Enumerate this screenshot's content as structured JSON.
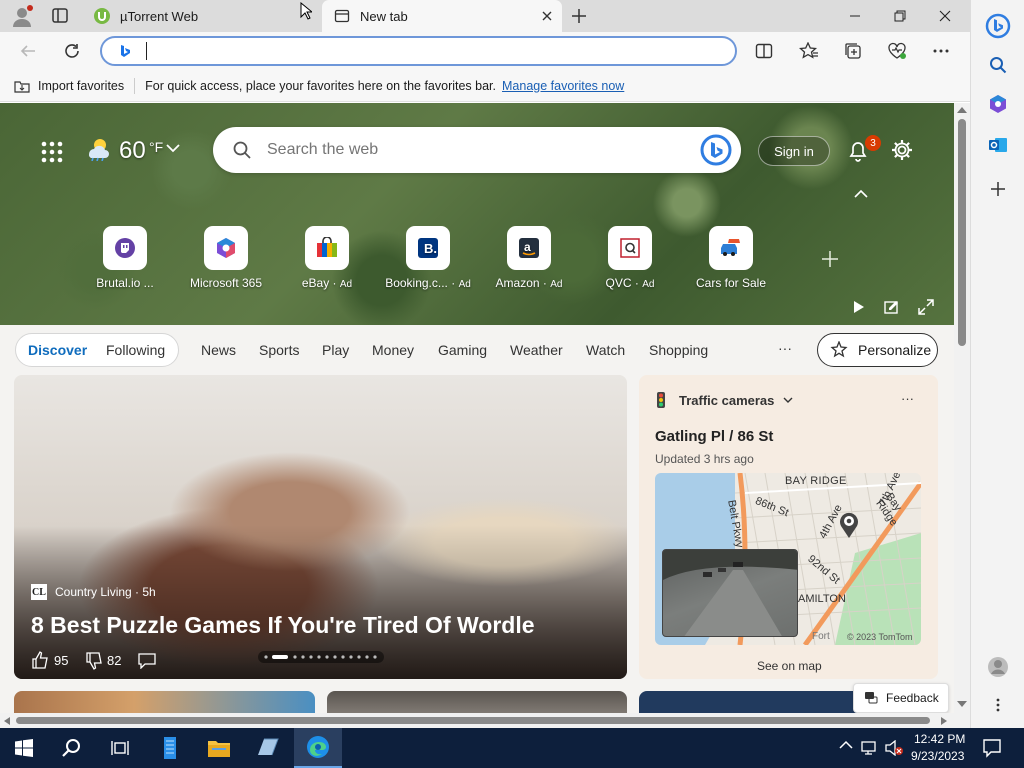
{
  "tabs": [
    {
      "title": "µTorrent Web"
    },
    {
      "title": "New tab"
    }
  ],
  "favorites_bar": {
    "import_label": "Import favorites",
    "message": "For quick access, place your favorites here on the favorites bar.",
    "manage_link": "Manage favorites now"
  },
  "weather": {
    "temp": "60",
    "unit": "°F"
  },
  "search": {
    "placeholder": "Search the web"
  },
  "header": {
    "sign_in": "Sign in",
    "notification_count": "3"
  },
  "quick_links": [
    {
      "label": "Brutal.io",
      "suffix": "...",
      "icon": "brutal-icon"
    },
    {
      "label": "Microsoft 365",
      "suffix": "",
      "icon": "m365-icon"
    },
    {
      "label": "eBay",
      "suffix": "Ad",
      "icon": "ebay-icon"
    },
    {
      "label": "Booking.c...",
      "suffix": "Ad",
      "icon": "booking-icon"
    },
    {
      "label": "Amazon",
      "suffix": "Ad",
      "icon": "amazon-icon"
    },
    {
      "label": "QVC",
      "suffix": "Ad",
      "icon": "qvc-icon"
    },
    {
      "label": "Cars for Sale",
      "suffix": "",
      "icon": "car-icon"
    }
  ],
  "nav": {
    "pills": [
      "Discover",
      "Following"
    ],
    "items": [
      "News",
      "Sports",
      "Play",
      "Money",
      "Gaming",
      "Weather",
      "Watch",
      "Shopping"
    ],
    "more": "···",
    "personalize": "Personalize"
  },
  "main_card": {
    "source_logo": "CL",
    "source": "Country Living · 5h",
    "headline": "8 Best Puzzle Games If You're Tired Of Wordle",
    "likes": "95",
    "dislikes": "82"
  },
  "traffic_card": {
    "title": "Traffic cameras",
    "location": "Gatling Pl / 86 St",
    "updated": "Updated 3 hrs ago",
    "map_labels": {
      "bay_ridge": "BAY RIDGE",
      "st86": "86th St",
      "belt": "Belt Pkwy",
      "ave4": "4th Ave",
      "st92": "92nd St",
      "ave7": "7th Ave",
      "bay_ridge_pkwy": "Bay Ridge",
      "hamilton": "AMILTON",
      "fort": "Fort",
      "copyright": "© 2023 TomTom"
    },
    "see_on_map": "See on map"
  },
  "feedback": "Feedback",
  "taskbar": {
    "time": "12:42 PM",
    "date": "9/23/2023"
  },
  "colors": {
    "accent": "#0f6cbd",
    "link": "#1a5fb4",
    "badge": "#d83b01",
    "taskbar": "#0d1f3c"
  }
}
